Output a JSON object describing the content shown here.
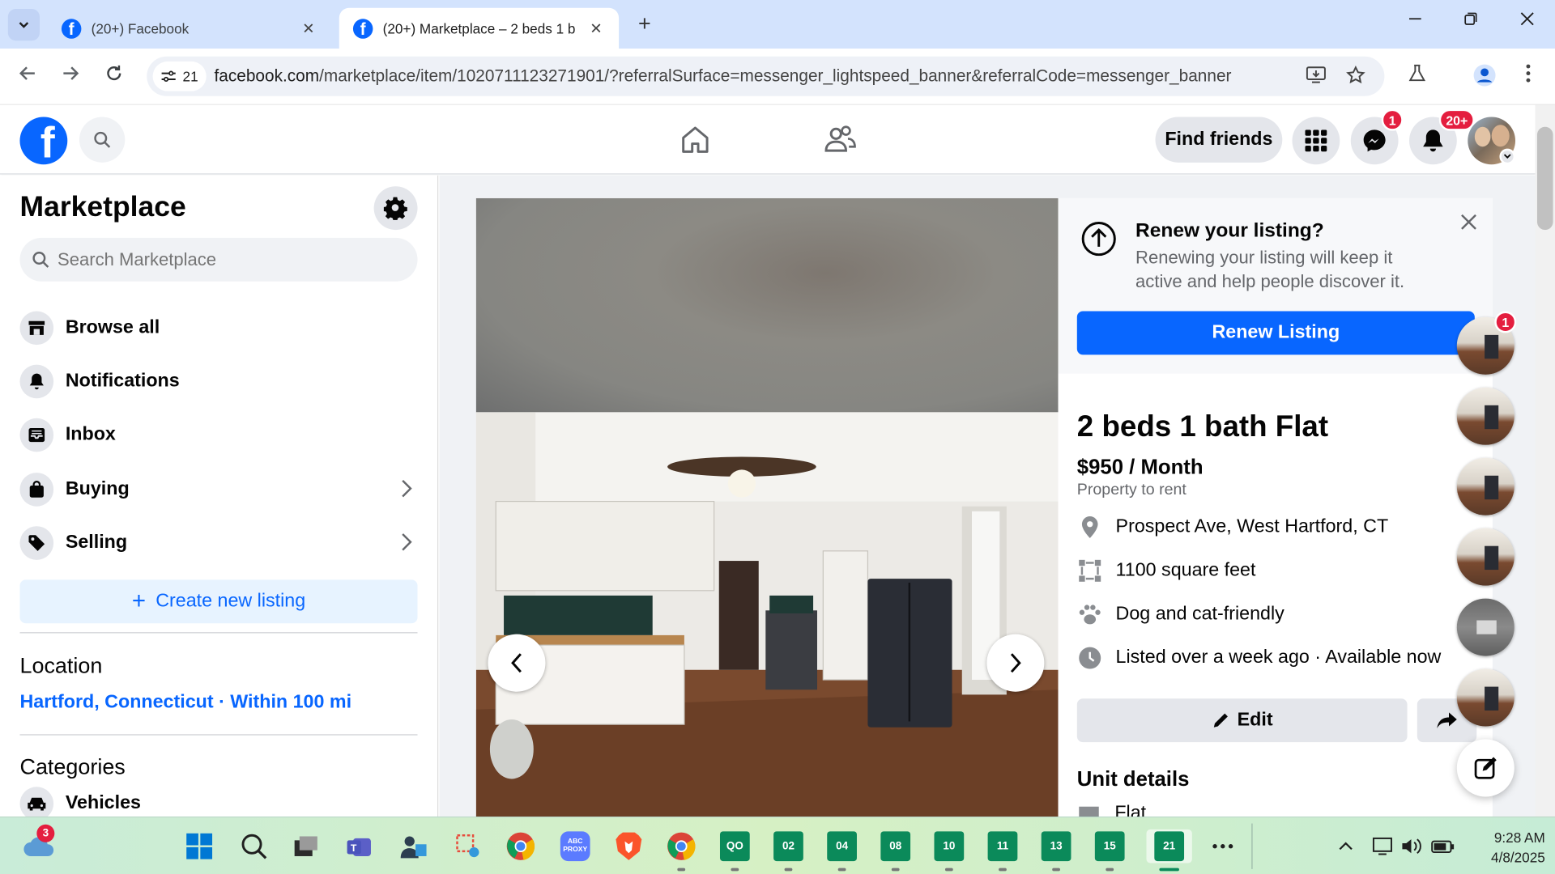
{
  "browser": {
    "tabs": [
      {
        "title": "(20+) Facebook",
        "active": false
      },
      {
        "title": "(20+) Marketplace – 2 beds 1 b",
        "active": true
      }
    ],
    "tab_count": "21",
    "url_host": "facebook.com",
    "url_path": "/marketplace/item/1020711123271901/?referralSurface=messenger_lightspeed_banner&referralCode=messenger_banner"
  },
  "header": {
    "find_friends": "Find friends",
    "messenger_badge": "1",
    "notifications_badge": "20+"
  },
  "sidebar": {
    "title": "Marketplace",
    "search_placeholder": "Search Marketplace",
    "items": [
      {
        "label": "Browse all",
        "icon": "store-icon"
      },
      {
        "label": "Notifications",
        "icon": "bell-icon"
      },
      {
        "label": "Inbox",
        "icon": "inbox-icon"
      },
      {
        "label": "Buying",
        "icon": "bag-icon"
      },
      {
        "label": "Selling",
        "icon": "tag-icon"
      }
    ],
    "create_listing": "Create new listing",
    "location_heading": "Location",
    "location_value": "Hartford, Connecticut · Within 100 mi",
    "categories_heading": "Categories",
    "first_category": "Vehicles"
  },
  "renew": {
    "title": "Renew your listing?",
    "description": "Renewing your listing will keep it active and help people discover it.",
    "button": "Renew Listing"
  },
  "listing": {
    "title": "2 beds 1 bath Flat",
    "price": "$950 / Month",
    "type": "Property to rent",
    "attributes": [
      {
        "text": "Prospect Ave, West Hartford, CT",
        "icon": "location-pin-icon"
      },
      {
        "text": "1100 square feet",
        "icon": "area-icon"
      },
      {
        "text": "Dog and cat-friendly",
        "icon": "paw-icon"
      },
      {
        "text": "Listed over a week ago · Available now",
        "icon": "clock-icon"
      }
    ],
    "edit_button": "Edit",
    "unit_details_heading": "Unit details",
    "unit_first_value": "Flat"
  },
  "chat_heads": {
    "first_badge": "1"
  },
  "taskbar": {
    "weather_badge": "3",
    "numbered_apps": [
      "02",
      "04",
      "08",
      "10",
      "11",
      "13",
      "15",
      "21"
    ],
    "proxy_label": "ABC PROXY",
    "time": "9:28 AM",
    "date": "4/8/2025"
  },
  "colors": {
    "facebook_blue": "#0866ff",
    "badge_red": "#e41e3f",
    "link_blue": "#0866ff"
  }
}
